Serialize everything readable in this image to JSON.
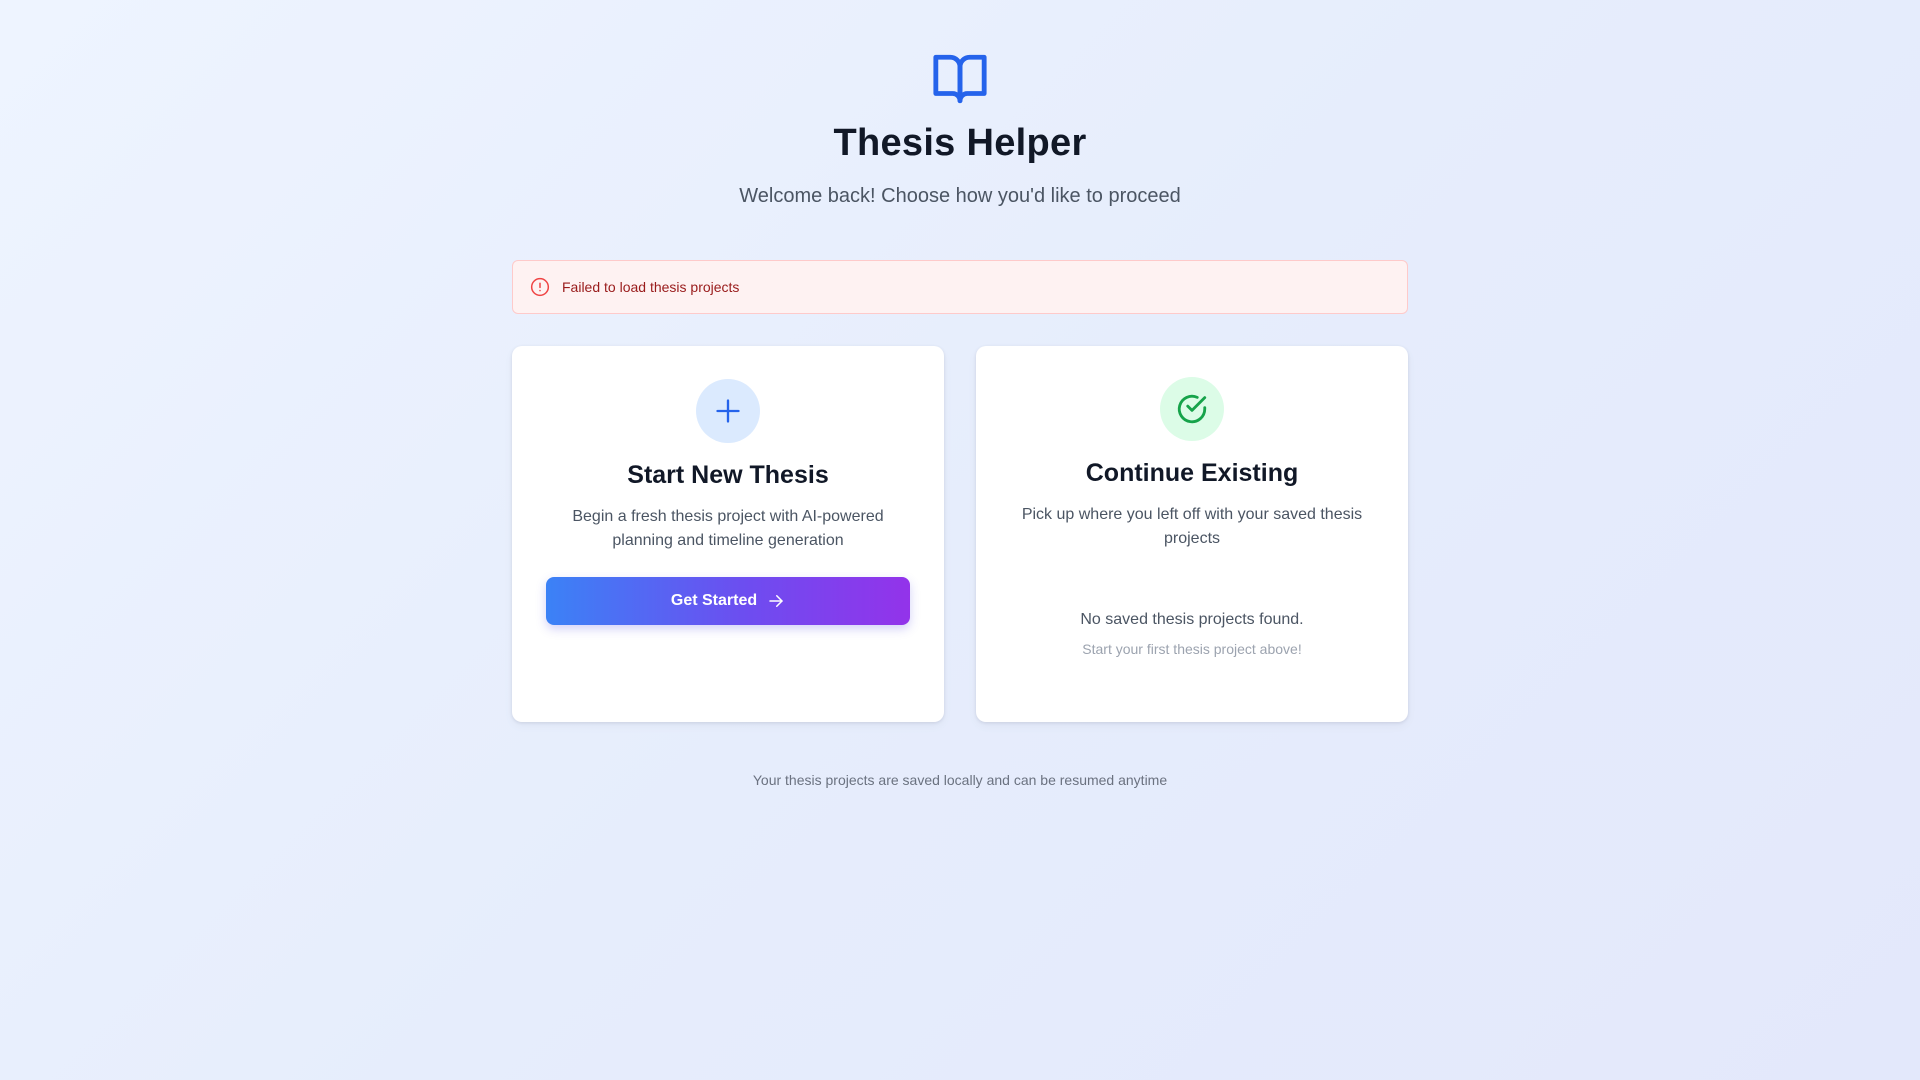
{
  "header": {
    "logo_icon": "book-open-icon",
    "title": "Thesis Helper",
    "subtitle": "Welcome back! Choose how you'd like to proceed"
  },
  "alert": {
    "icon": "alert-circle-icon",
    "message": "Failed to load thesis projects"
  },
  "new_thesis_card": {
    "icon": "plus-icon",
    "title": "Start New Thesis",
    "description": "Begin a fresh thesis project with AI-powered planning and timeline generation",
    "button_label": "Get Started",
    "button_icon": "arrow-right-icon"
  },
  "existing_card": {
    "icon": "check-circle-icon",
    "title": "Continue Existing",
    "description": "Pick up where you left off with your saved thesis projects",
    "empty_title": "No saved thesis projects found.",
    "empty_hint": "Start your first thesis project above!"
  },
  "footer": {
    "note": "Your thesis projects are saved locally and can be resumed anytime"
  },
  "colors": {
    "primary": "#2563eb",
    "success": "#16a34a",
    "error": "#ef4444",
    "gradient_start": "#3b82f6",
    "gradient_end": "#9333ea"
  }
}
